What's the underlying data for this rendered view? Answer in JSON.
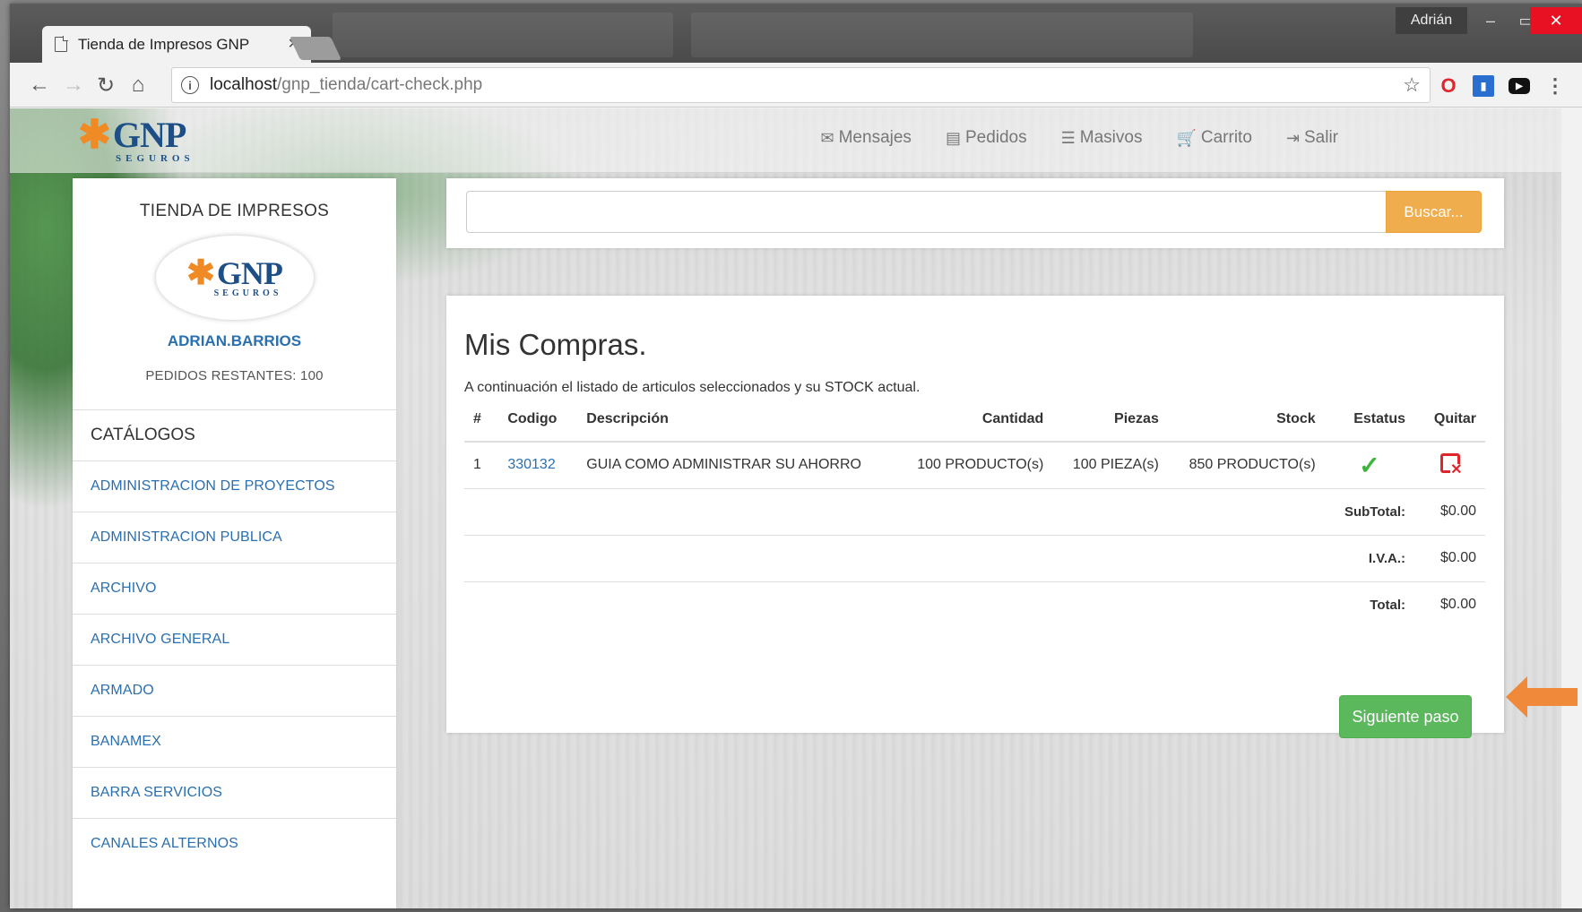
{
  "browser": {
    "tab_title": "Tienda de Impresos GNP",
    "tab_close": "×",
    "user_badge": "Adrián",
    "url_host": "localhost",
    "url_path": "/gnp_tienda/cart-check.php"
  },
  "brand": {
    "logo_text": "GNP",
    "logo_sub": "SEGUROS"
  },
  "nav": [
    {
      "icon": "envelope-icon",
      "glyph": "✉",
      "label": "Mensajes"
    },
    {
      "icon": "list-icon",
      "glyph": "▤",
      "label": "Pedidos"
    },
    {
      "icon": "bulk-list-icon",
      "glyph": "☰",
      "label": "Masivos"
    },
    {
      "icon": "cart-icon",
      "glyph": "🛒",
      "label": "Carrito"
    },
    {
      "icon": "logout-icon",
      "glyph": "⇥",
      "label": "Salir"
    }
  ],
  "sidebar": {
    "title": "TIENDA DE IMPRESOS",
    "username": "ADRIAN.BARRIOS",
    "pedidos": "PEDIDOS RESTANTES: 100",
    "catalog_heading": "CATÁLOGOS",
    "items": [
      "ADMINISTRACION DE PROYECTOS",
      "ADMINISTRACION PUBLICA",
      "ARCHIVO",
      "ARCHIVO GENERAL",
      "ARMADO",
      "BANAMEX",
      "BARRA SERVICIOS",
      "CANALES ALTERNOS"
    ]
  },
  "search": {
    "value": "",
    "placeholder": "",
    "button": "Buscar..."
  },
  "cart": {
    "title": "Mis Compras.",
    "subtitle": "A continuación el listado de articulos seleccionados y su STOCK actual.",
    "columns": [
      "#",
      "Codigo",
      "Descripción",
      "Cantidad",
      "Piezas",
      "Stock",
      "Estatus",
      "Quitar"
    ],
    "rows": [
      {
        "num": "1",
        "code": "330132",
        "description": "GUIA COMO ADMINISTRAR SU AHORRO",
        "quantity": "100 PRODUCTO(s)",
        "pieces": "100 PIEZA(s)",
        "stock": "850 PRODUCTO(s)",
        "status": "✓"
      }
    ],
    "subtotal_label": "SubTotal:",
    "subtotal_value": "$0.00",
    "iva_label": "I.V.A.:",
    "iva_value": "$0.00",
    "total_label": "Total:",
    "total_value": "$0.00",
    "next_button": "Siguiente paso"
  },
  "colors": {
    "brand_blue": "#1d4f86",
    "brand_orange": "#f08a24",
    "link_blue": "#2a6fb0",
    "search_button": "#f0ad4e",
    "next_button": "#5cb85c",
    "arrow": "#f08a3a"
  }
}
